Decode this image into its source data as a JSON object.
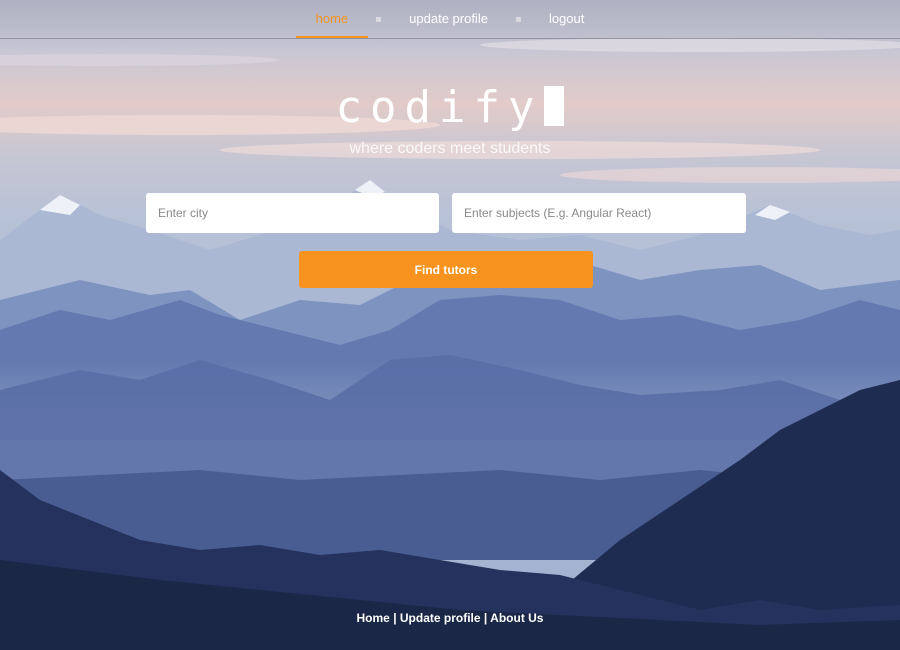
{
  "nav": {
    "items": [
      {
        "label": "home",
        "active": true
      },
      {
        "label": "update profile",
        "active": false
      },
      {
        "label": "logout",
        "active": false
      }
    ]
  },
  "hero": {
    "logo": "codify",
    "tagline": "where coders meet students"
  },
  "search": {
    "city_placeholder": "Enter city",
    "subjects_placeholder": "Enter subjects (E.g. Angular React)",
    "button_label": "Find tutors"
  },
  "footer": {
    "links": [
      "Home",
      "Update profile",
      "About Us"
    ],
    "separator": "|"
  },
  "colors": {
    "accent": "#f7941d",
    "button": "#f7931e"
  }
}
